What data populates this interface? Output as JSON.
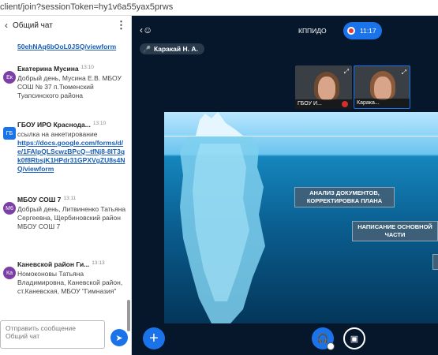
{
  "browser": {
    "url": "client/join?sessionToken=hy1v6a55yax5prws"
  },
  "chat": {
    "title": "Общий чат",
    "top_link": "50ehNAq6bOoL0JSQ/viewform",
    "messages": [
      {
        "initials": "Ек",
        "color": "#7b3fa5",
        "name": "Екатерина Мусина",
        "time": "13:10",
        "text": "Добрый день, Мусина Е.В. МБОУ СОШ № 37 п.Тюменский Туапсинского района"
      },
      {
        "initials": "ГБ",
        "color": "#1a73e8",
        "name": "ГБОУ ИРО Краснода...",
        "time": "13:10",
        "text": "ссылка на анкетирование",
        "link": "https://docs.google.com/forms/d/e/1FAIpQLScwzBPcQ--tfNj8-8IT3qk0f8RbsjK1HPdr31GPXVgZU8s4NQ/viewform"
      },
      {
        "initials": "М6",
        "color": "#7b3fa5",
        "name": "МБОУ СОШ 7",
        "time": "13:11",
        "text": "Добрый день, Литвиненко Татьяна Сергеевна, Щербиновский район МБОУ СОШ 7"
      },
      {
        "initials": "Ка",
        "color": "#7b3fa5",
        "name": "Каневской район Ги...",
        "time": "13:13",
        "text": "Номоконовы Татьяна Владимировна, Каневской район, ст.Каневская, МБОУ \"Гимназия\""
      }
    ],
    "input_placeholder": "Отправить сообщение Общий чат"
  },
  "conference": {
    "room_name": "КППИДО",
    "recording_time": "11:17",
    "presenter": "Каракай Н. А.",
    "cameras": [
      {
        "label": "ГБОУ И..."
      },
      {
        "label": "Карака..."
      }
    ],
    "slide_labels": [
      "АНАЛИЗ ДОКУМЕНТОВ, КОРРЕКТИРОВКА ПЛАНА",
      "НАПИСАНИЕ ОСНОВНОЙ ЧАСТИ"
    ]
  }
}
